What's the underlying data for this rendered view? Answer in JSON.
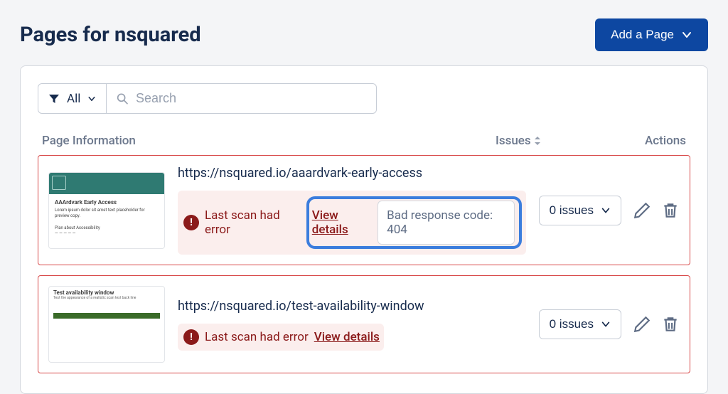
{
  "header": {
    "title": "Pages for nsquared",
    "add_button": "Add a Page"
  },
  "filter": {
    "option": "All",
    "search_placeholder": "Search"
  },
  "columns": {
    "info": "Page Information",
    "issues": "Issues",
    "actions": "Actions"
  },
  "rows": [
    {
      "url": "https://nsquared.io/aaardvark-early-access",
      "error_text": "Last scan had error",
      "view_details": "View details",
      "tooltip": "Bad response code: 404",
      "issues_label": "0 issues",
      "thumb": {
        "kind": "aardvark",
        "title": "AAArdvark Early Access"
      }
    },
    {
      "url": "https://nsquared.io/test-availability-window",
      "error_text": "Last scan had error",
      "view_details": "View details",
      "issues_label": "0 issues",
      "thumb": {
        "kind": "availability",
        "title": "Test availability window"
      }
    }
  ]
}
